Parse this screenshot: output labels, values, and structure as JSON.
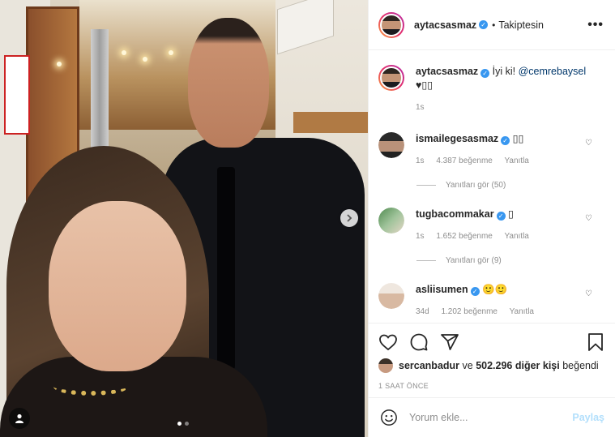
{
  "post": {
    "author": "aytacsasmaz",
    "follow_state": "Takiptesin",
    "more_icon": "more-horizontal-icon",
    "carousel": {
      "next_icon": "chevron-right-icon",
      "tag_icon": "user-tag-icon",
      "slide_count": 2,
      "active_slide": 1
    }
  },
  "caption": {
    "username": "aytacsasmaz",
    "text": "İyi ki! ",
    "mention": "@cemrebaysel",
    "second_line": "♥▯▯",
    "age": "1s"
  },
  "comments": [
    {
      "username": "ismailegesasmaz",
      "text": "▯▯",
      "age": "1s",
      "likes": "4.387 beğenme",
      "reply": "Yanıtla",
      "view_replies": "Yanıtları gör (50)"
    },
    {
      "username": "tugbacommakar",
      "text": "▯",
      "age": "1s",
      "likes": "1.652 beğenme",
      "reply": "Yanıtla",
      "view_replies": "Yanıtları gör (9)"
    },
    {
      "username": "asliisumen",
      "text": "🙂🙂",
      "age": "34d",
      "likes": "1.202 beğenme",
      "reply": "Yanıtla"
    }
  ],
  "likes": {
    "liker": "sercanbadur",
    "connector": " ve ",
    "count": "502.296 diğer kişi",
    "suffix": " beğendi"
  },
  "timestamp": "1 SAAT ÖNCE",
  "comment_box": {
    "placeholder": "Yorum ekle...",
    "post_label": "Paylaş"
  },
  "colors": {
    "link": "#00376b",
    "verified": "#3897f0",
    "muted": "#8e8e8e",
    "post_disabled": "#b2dffc"
  }
}
